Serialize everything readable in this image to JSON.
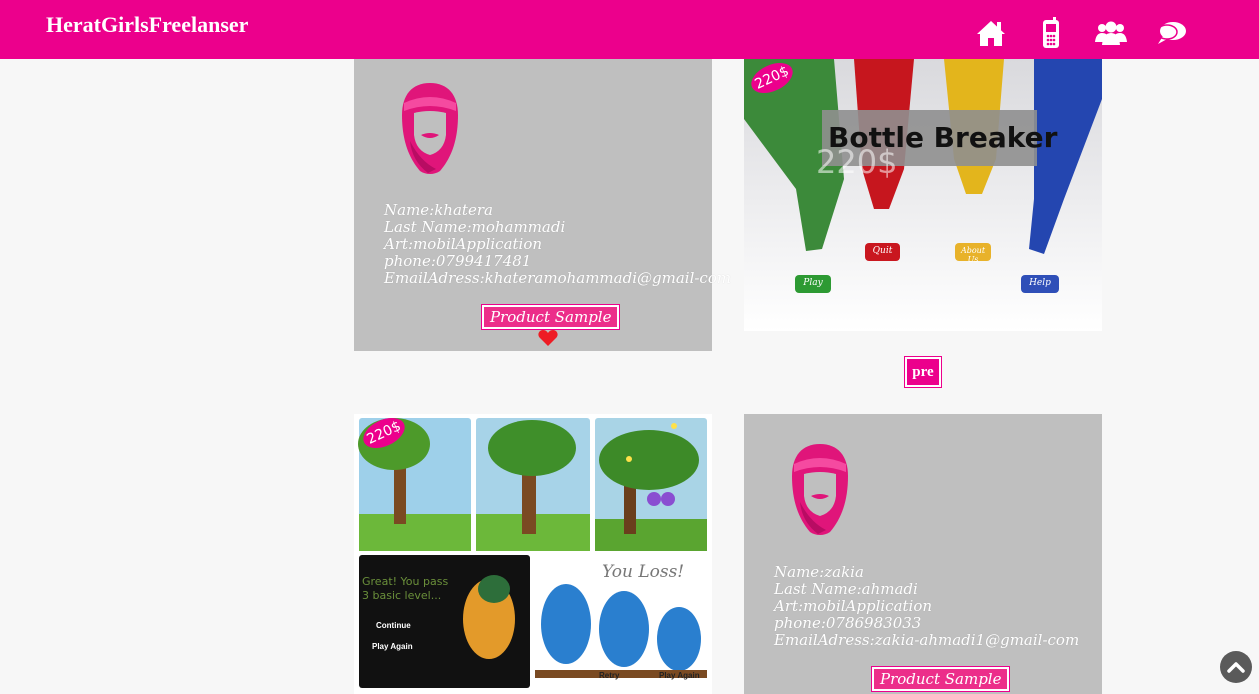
{
  "header": {
    "brand": "HeratGirlsFreelanser",
    "nav": [
      {
        "icon": "home-icon"
      },
      {
        "icon": "mobile-phone-icon"
      },
      {
        "icon": "users-group-icon"
      },
      {
        "icon": "chat-bubbles-icon"
      }
    ]
  },
  "cards": [
    {
      "name": "Name:khatera",
      "last_name": "Last Name:mohammadi",
      "art": "Art:mobilApplication",
      "phone": "phone:0799417481",
      "email": "EmailAdress:khateramohammadi@gmail-com",
      "button": "Product Sample"
    },
    {
      "name": "Name:zakia",
      "last_name": "Last Name:ahmadi",
      "art": "Art:mobilApplication",
      "phone": "phone:0786983033",
      "email": "EmailAdress:zakia-ahmadi1@gmail-com",
      "button": "Product Sample"
    }
  ],
  "product1": {
    "price": "220$",
    "title": "Bottle Breaker",
    "ghost_price": "220$",
    "buttons": [
      "Play",
      "Quit",
      "About Us",
      "Help"
    ]
  },
  "pager": {
    "pre": "pre"
  },
  "product2": {
    "price": "220$",
    "pass_text_1": "Great! You pass",
    "pass_text_2": "3 basic level...",
    "continue": "Continue",
    "play_again": "Play Again",
    "loss_text": "You Loss!",
    "retry": "Retry",
    "play_again_2": "Play Again"
  },
  "colors": {
    "accent": "#ec008c",
    "card": "#bfbfbf",
    "heart": "#ee1c24"
  }
}
